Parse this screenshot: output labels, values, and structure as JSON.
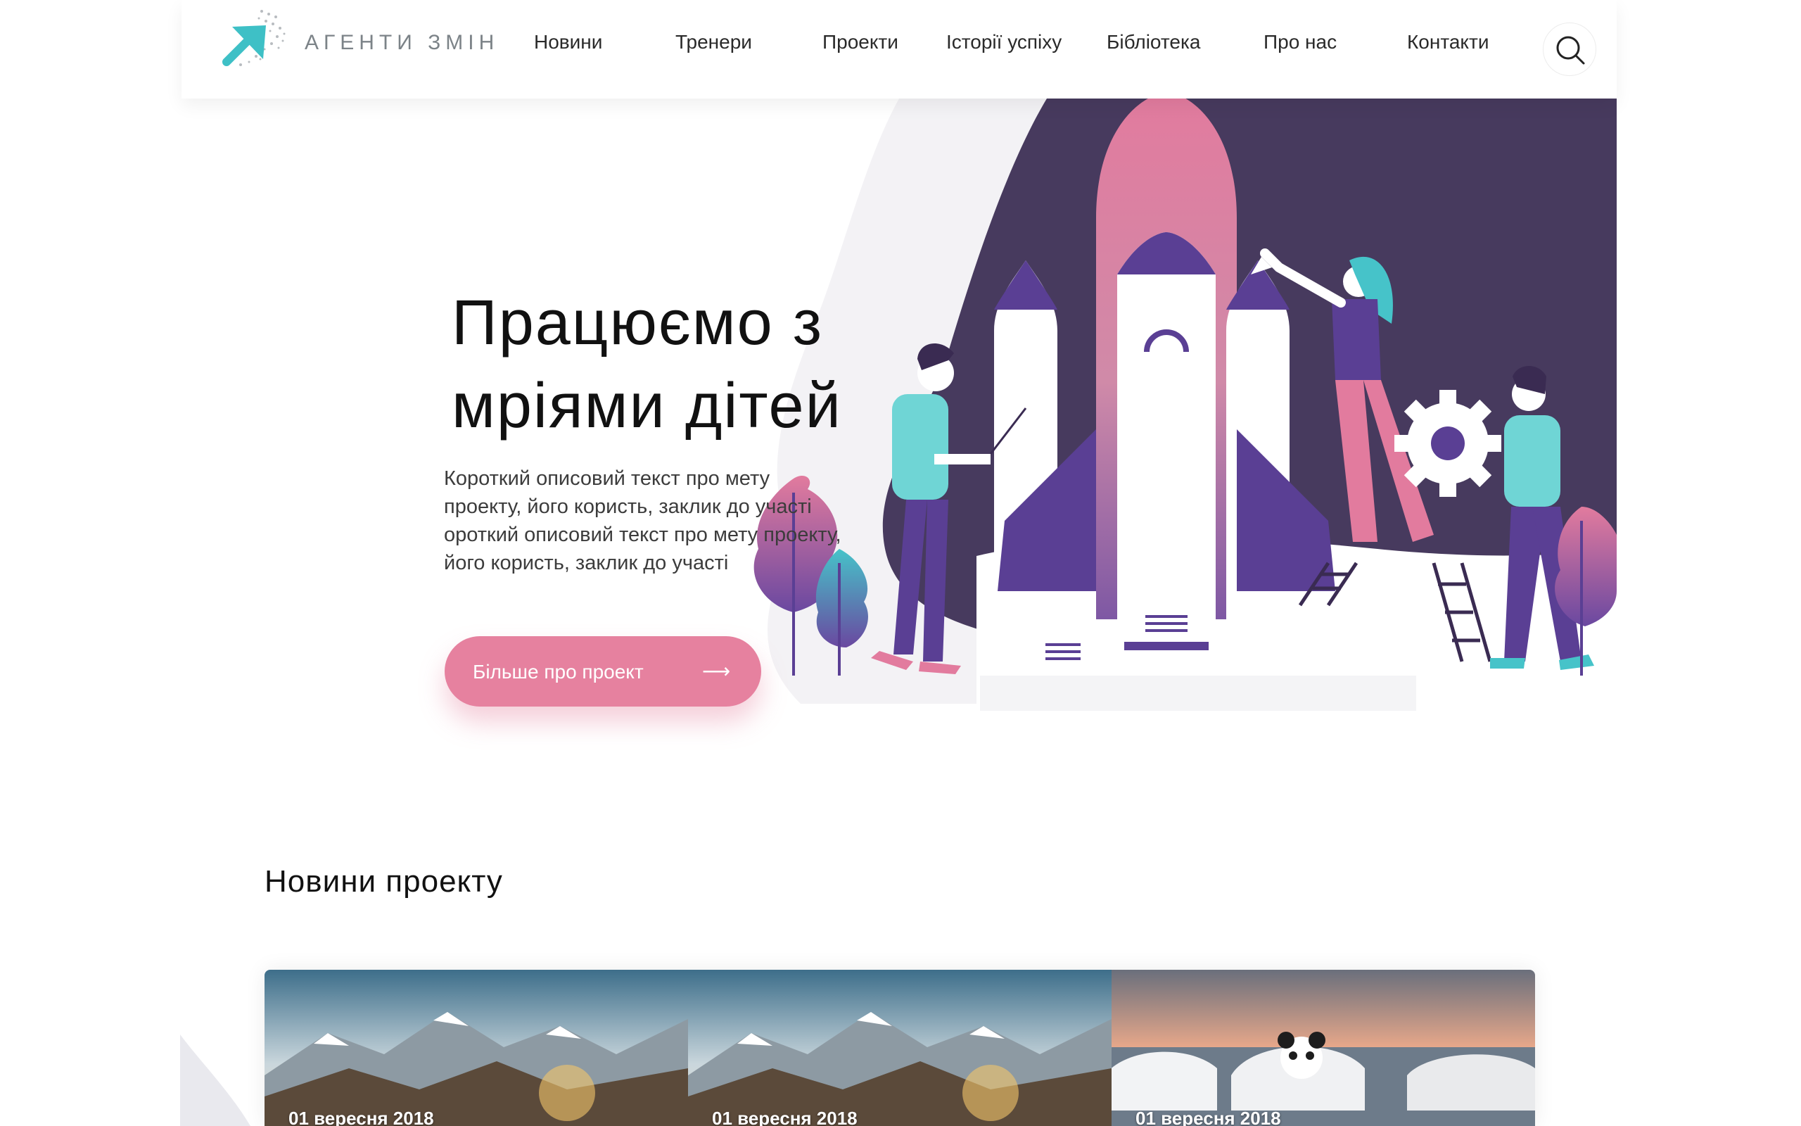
{
  "header": {
    "logo_text": "АГЕНТИ ЗМІН",
    "nav": [
      {
        "label": "Новини"
      },
      {
        "label": "Тренери"
      },
      {
        "label": "Проекти"
      },
      {
        "label": "Історії успіху"
      },
      {
        "label": "Бібліотека"
      },
      {
        "label": "Про нас"
      },
      {
        "label": "Контакти"
      }
    ]
  },
  "hero": {
    "title_line1": "Працюємо з",
    "title_line2": "мріями дітей",
    "text_line1": "Короткий описовий текст про мету",
    "text_line2": "проекту, його користь, заклик до участі",
    "text_line3": "ороткий описовий текст про мету проекту,",
    "text_line4": "його користь, заклик до участі",
    "cta_label": "Більше про проект",
    "cta_arrow": "⟶"
  },
  "news": {
    "title": "Новини проекту",
    "cards": [
      {
        "date": "01 вересня 2018",
        "image": "mountains"
      },
      {
        "date": "01 вересня 2018",
        "image": "mountains"
      },
      {
        "date": "01 вересня 2018",
        "image": "cars-panda"
      }
    ]
  },
  "colors": {
    "accent_pink": "#e6819f",
    "accent_teal": "#46c3c9",
    "dark_purple": "#4a3a60",
    "rocket_purple": "#5a3f94"
  },
  "icons": {
    "search": "search-icon",
    "arrow": "arrow-right-icon"
  }
}
